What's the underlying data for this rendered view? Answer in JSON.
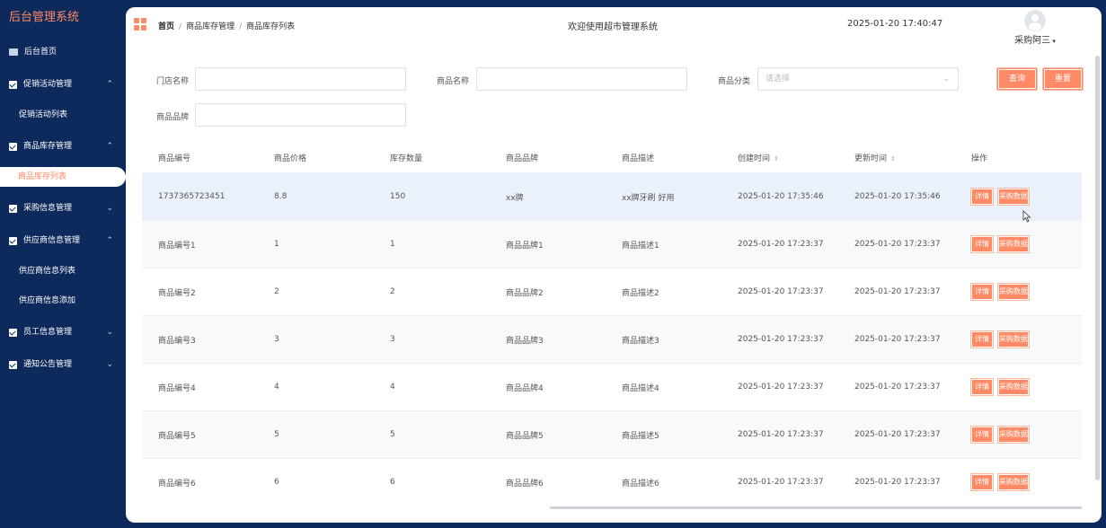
{
  "sidebar": {
    "brand": "后台管理系统",
    "items": [
      {
        "label": "后台首页",
        "icon": "monitor-icon",
        "chevron": ""
      },
      {
        "label": "促销活动管理",
        "icon": "check-icon",
        "chevron": "⌃"
      },
      {
        "label": "促销活动列表",
        "sub": true
      },
      {
        "label": "商品库存管理",
        "icon": "check-icon",
        "chevron": "⌃"
      },
      {
        "label": "商品库存列表",
        "sub": true,
        "active": true
      },
      {
        "label": "采购信息管理",
        "icon": "check-icon",
        "chevron": "⌄"
      },
      {
        "label": "供应商信息管理",
        "icon": "check-icon",
        "chevron": "⌃"
      },
      {
        "label": "供应商信息列表",
        "sub": true
      },
      {
        "label": "供应商信息添加",
        "sub": true
      },
      {
        "label": "员工信息管理",
        "icon": "check-icon",
        "chevron": "⌄"
      },
      {
        "label": "通知公告管理",
        "icon": "check-icon",
        "chevron": "⌄"
      }
    ]
  },
  "header": {
    "breadcrumb": [
      "首页",
      "商品库存管理",
      "商品库存列表"
    ],
    "welcome": "欢迎使用超市管理系统",
    "datetime": "2025-01-20 17:40:47",
    "username": "采购阿三"
  },
  "filters": {
    "store_label": "门店名称",
    "product_label": "商品名称",
    "category_label": "商品分类",
    "category_placeholder": "请选择",
    "brand_label": "商品品牌",
    "query_button": "查询",
    "reset_button": "重置"
  },
  "table": {
    "headers": [
      "商品编号",
      "商品价格",
      "库存数量",
      "商品品牌",
      "商品描述",
      "创建时间",
      "更新时间",
      "操作"
    ],
    "action_detail": "详情",
    "action_purchase": "采购数据",
    "rows": [
      [
        "1737365723451",
        "8.8",
        "150",
        "xx牌",
        "xx牌牙刷 好用",
        "2025-01-20 17:35:46",
        "2025-01-20 17:35:46"
      ],
      [
        "商品编号1",
        "1",
        "1",
        "商品品牌1",
        "商品描述1",
        "2025-01-20 17:23:37",
        "2025-01-20 17:23:37"
      ],
      [
        "商品编号2",
        "2",
        "2",
        "商品品牌2",
        "商品描述2",
        "2025-01-20 17:23:37",
        "2025-01-20 17:23:37"
      ],
      [
        "商品编号3",
        "3",
        "3",
        "商品品牌3",
        "商品描述3",
        "2025-01-20 17:23:37",
        "2025-01-20 17:23:37"
      ],
      [
        "商品编号4",
        "4",
        "4",
        "商品品牌4",
        "商品描述4",
        "2025-01-20 17:23:37",
        "2025-01-20 17:23:37"
      ],
      [
        "商品编号5",
        "5",
        "5",
        "商品品牌5",
        "商品描述5",
        "2025-01-20 17:23:37",
        "2025-01-20 17:23:37"
      ],
      [
        "商品编号6",
        "6",
        "6",
        "商品品牌6",
        "商品描述6",
        "2025-01-20 17:23:37",
        "2025-01-20 17:23:37"
      ]
    ]
  },
  "colors": {
    "sidebar_bg": "#0e2a5c",
    "accent": "#ff8a65",
    "highlight_row": "#ebf1fb"
  }
}
